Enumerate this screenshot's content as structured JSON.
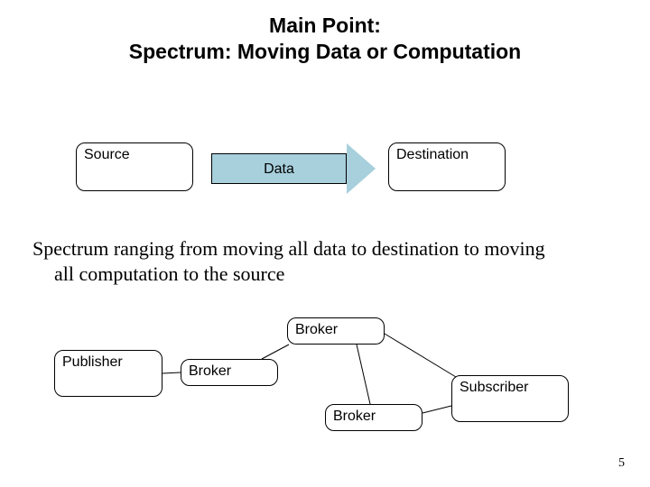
{
  "title_line1": "Main Point:",
  "title_line2": "Spectrum: Moving Data or Computation",
  "top": {
    "source": "Source",
    "destination": "Destination",
    "arrow_label": "Data"
  },
  "caption_line1": "Spectrum ranging from moving all data to destination to moving",
  "caption_line2": "all computation to the source",
  "bottom": {
    "publisher": "Publisher",
    "broker1": "Broker",
    "broker2": "Broker",
    "broker3": "Broker",
    "subscriber": "Subscriber"
  },
  "page_number": "5"
}
